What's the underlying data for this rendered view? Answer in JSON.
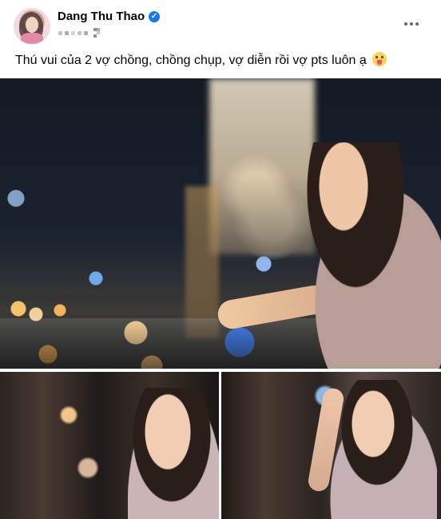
{
  "post": {
    "author_name": "Dang Thu Thao",
    "caption": "Thú vui của 2 vợ chồng, chồng chụp, vợ diễn rồi vợ pts luôn ạ",
    "icons": {
      "verified": "verified-badge-icon",
      "privacy": "audience-icon",
      "more": "more-options-icon",
      "emoji": "tongue-out-emoji"
    },
    "colors": {
      "verified_badge": "#1877f2",
      "text": "#050505",
      "secondary": "#65676b"
    },
    "photos": [
      {
        "name": "woman leaning on balcony rail at night with city lights"
      },
      {
        "name": "woman portrait in dark room"
      },
      {
        "name": "woman touching hair by window"
      }
    ]
  }
}
